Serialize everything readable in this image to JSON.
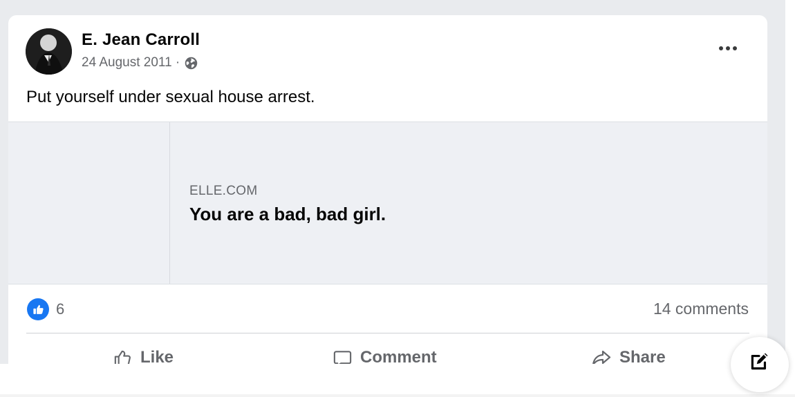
{
  "post": {
    "author_name": "E. Jean Carroll",
    "date": "24 August 2011 ·",
    "text": "Put yourself under sexual house arrest.",
    "audience_icon": "globe-icon",
    "menu_icon": "more-horizontal-icon"
  },
  "link_preview": {
    "domain": "ELLE.COM",
    "title": "You are a bad, bad girl."
  },
  "engagement": {
    "reaction_icon": "like-reaction-icon",
    "reaction_count": "6",
    "comments": "14 comments"
  },
  "actions": {
    "like_label": "Like",
    "comment_label": "Comment",
    "share_label": "Share"
  },
  "colors": {
    "background": "#e9ebee",
    "card": "#ffffff",
    "text": "#050505",
    "secondary_text": "#65676b",
    "accent": "#1877f2",
    "preview": "#eef0f4"
  },
  "floating_button_icon": "compose-icon"
}
